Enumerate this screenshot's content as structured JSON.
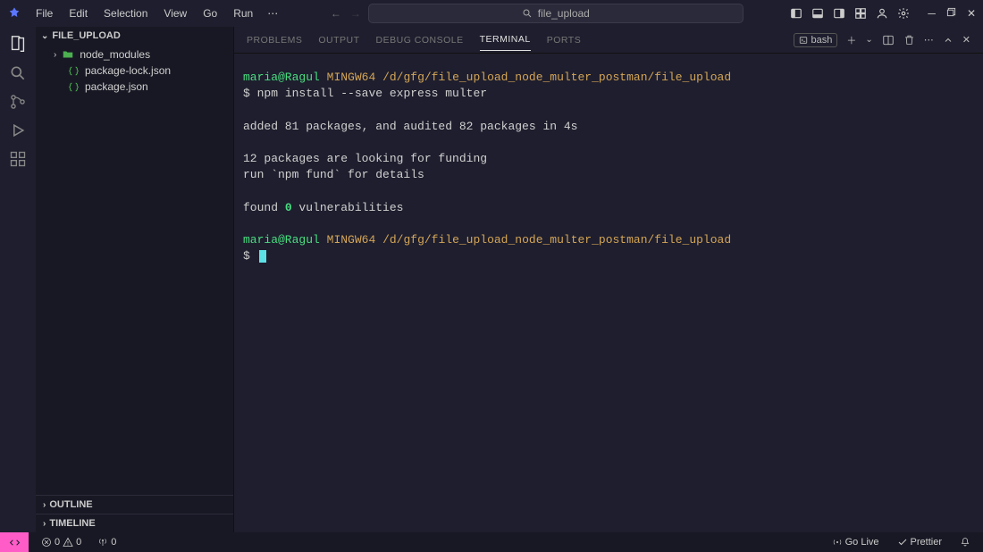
{
  "menu": {
    "file": "File",
    "edit": "Edit",
    "selection": "Selection",
    "view": "View",
    "go": "Go",
    "run": "Run"
  },
  "search": {
    "text": "file_upload"
  },
  "activity": {
    "explorer": "Explorer",
    "search": "Search",
    "scm": "Source Control",
    "debug": "Run and Debug",
    "extensions": "Extensions"
  },
  "explorer": {
    "folder": "FILE_UPLOAD",
    "items": [
      {
        "name": "node_modules",
        "type": "folder"
      },
      {
        "name": "package-lock.json",
        "type": "file"
      },
      {
        "name": "package.json",
        "type": "file"
      }
    ],
    "outline": "OUTLINE",
    "timeline": "TIMELINE"
  },
  "panelTabs": {
    "problems": "PROBLEMS",
    "output": "OUTPUT",
    "debug": "DEBUG CONSOLE",
    "terminal": "TERMINAL",
    "ports": "PORTS"
  },
  "panelRight": {
    "shell": "bash"
  },
  "terminal": {
    "user": "maria@Ragul",
    "env": "MINGW64",
    "path": "/d/gfg/file_upload_node_multer_postman/file_upload",
    "cmd": "npm install --save express multer",
    "line_added": "added 81 packages, and audited 82 packages in 4s",
    "line_funding1": "12 packages are looking for funding",
    "line_funding2": "  run `npm fund` for details",
    "line_vuln_pre": "found ",
    "line_vuln_num": "0",
    "line_vuln_post": " vulnerabilities",
    "prompt": "$"
  },
  "status": {
    "errors": "0",
    "warnings": "0",
    "port": "0",
    "golive": "Go Live",
    "prettier": "Prettier"
  }
}
